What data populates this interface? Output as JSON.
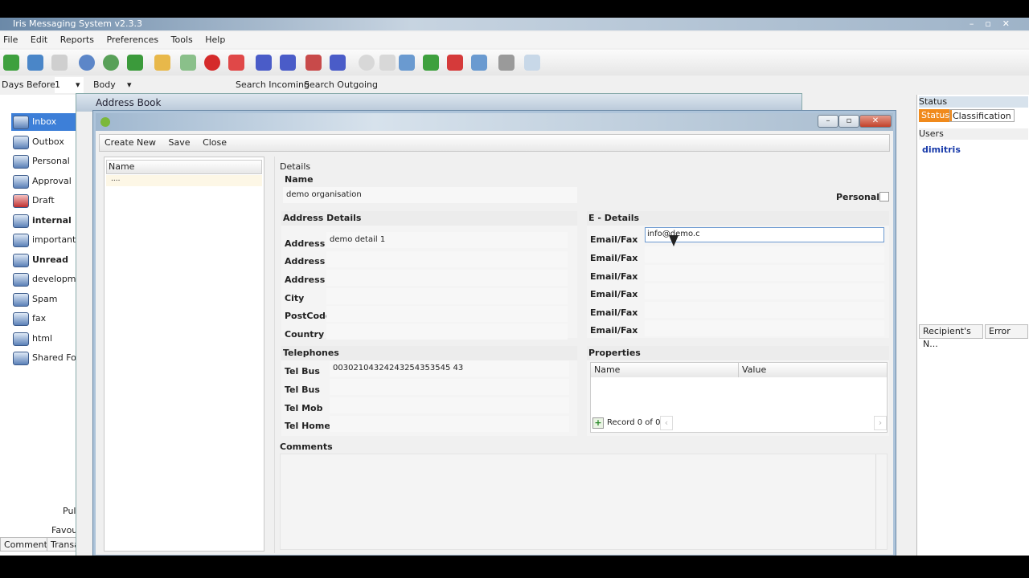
{
  "app": {
    "title": "Iris Messaging System v2.3.3"
  },
  "menu": [
    "File",
    "Edit",
    "Reports",
    "Preferences",
    "Tools",
    "Help"
  ],
  "options": {
    "days_before_label": "Days Before:",
    "days_before_value": "1",
    "body_value": "Body",
    "search_incoming": "Search Incoming",
    "search_outgoing": "Search Outgoing"
  },
  "nav": {
    "items": [
      {
        "label": "Inbox",
        "bold": false
      },
      {
        "label": "Outbox",
        "bold": false
      },
      {
        "label": "Personal",
        "bold": false
      },
      {
        "label": "Approval",
        "bold": false
      },
      {
        "label": "Draft",
        "bold": false
      },
      {
        "label": "internal",
        "bold": true
      },
      {
        "label": "important",
        "bold": false
      },
      {
        "label": "Unread",
        "bold": true
      },
      {
        "label": "developme",
        "bold": false
      },
      {
        "label": "Spam",
        "bold": false
      },
      {
        "label": "fax",
        "bold": false
      },
      {
        "label": "html",
        "bold": false
      },
      {
        "label": "Shared Fol",
        "bold": false
      }
    ],
    "bottom": [
      "Pul",
      "Favou"
    ],
    "tabs": [
      "Comments",
      "Transa"
    ]
  },
  "right_pane": {
    "title": "Status",
    "tabs": [
      "Status",
      "Classification"
    ],
    "users_label": "Users",
    "user": "dimitris",
    "cols": [
      "Recipient's N...",
      "Error"
    ]
  },
  "address_book": {
    "title": "Address Book"
  },
  "form": {
    "commands": [
      "Create New",
      "Save",
      "Close"
    ],
    "list_header": "Name",
    "list_row": "....",
    "details_label": "Details",
    "name_label": "Name",
    "name_value": "demo organisation",
    "personal_label": "Personal",
    "address_group": "Address Details",
    "address_rows": [
      {
        "label": "Address",
        "value": "demo detail 1"
      },
      {
        "label": "Address",
        "value": ""
      },
      {
        "label": "Address",
        "value": ""
      },
      {
        "label": "City",
        "value": ""
      },
      {
        "label": "PostCode",
        "value": ""
      },
      {
        "label": "Country",
        "value": ""
      }
    ],
    "edetails_group": "E - Details",
    "email_rows": [
      {
        "label": "Email/Fax",
        "value": "info@demo.c"
      },
      {
        "label": "Email/Fax",
        "value": ""
      },
      {
        "label": "Email/Fax",
        "value": ""
      },
      {
        "label": "Email/Fax",
        "value": ""
      },
      {
        "label": "Email/Fax",
        "value": ""
      },
      {
        "label": "Email/Fax",
        "value": ""
      }
    ],
    "tel_group": "Telephones",
    "tel_rows": [
      {
        "label": "Tel Bus",
        "value": "00302104324243254353545 43"
      },
      {
        "label": "Tel Bus",
        "value": ""
      },
      {
        "label": "Tel Mob",
        "value": ""
      },
      {
        "label": "Tel Home",
        "value": ""
      }
    ],
    "props_group": "Properties",
    "props_cols": [
      "Name",
      "Value"
    ],
    "record_text": "Record 0 of 0",
    "comments_label": "Comments"
  }
}
